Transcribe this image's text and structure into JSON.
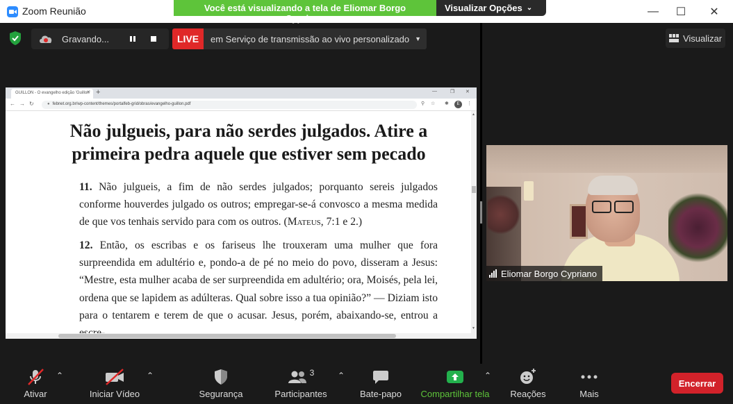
{
  "window": {
    "title": "Zoom Reunião"
  },
  "share_banner": {
    "text": "Você está visualizando a tela de Eliomar Borgo Cypriano",
    "options_label": "Visualizar Opções"
  },
  "status": {
    "recording_label": "Gravando...",
    "live_label": "LIVE",
    "stream_label": "em Serviço de transmissão ao vivo personalizado"
  },
  "view_button": {
    "label": "Visualizar"
  },
  "browser": {
    "tab_title": "GUILLON - O evangelho edição 'Guillon'",
    "url": "febnet.org.br/wp-content/themes/portalfeb-grid/obras/evangelho-guillon.pdf",
    "avatar_letter": "E"
  },
  "document": {
    "title_line1": "Não julgueis, para não serdes julgados. Atire a",
    "title_line2": "primeira pedra aquele que estiver sem pecado",
    "p11_num": "11.",
    "p11_text": "Não julgueis, a fim de não serdes julgados; porquanto sereis julgados conforme houverdes julgado os outros; empregar-se-á convosco a mesma medida de que vos tenhais servido para com os outros. (",
    "p11_ref_name": "Mateus",
    "p11_ref": ", 7:1 e 2.)",
    "p12_num": "12.",
    "p12_text": "Então, os escribas e os fariseus lhe trouxeram uma mulher que fora surpreendida em adultério e, pondo-a de pé no meio do povo, disseram a Jesus: “Mestre, esta mulher acaba de ser surpreendida em adultério; ora, Moisés, pela lei, ordena que se lapidem as adúlteras. Qual sobre isso a tua opinião?” — Diziam isto para o tentarem e terem de que o acusar. Jesus, porém, abaixando-se, entrou a escre-"
  },
  "participant": {
    "name": "Eliomar Borgo Cypriano"
  },
  "toolbar": {
    "mute_label": "Ativar",
    "video_label": "Iniciar Vídeo",
    "security_label": "Segurança",
    "participants_label": "Participantes",
    "participants_count": "3",
    "chat_label": "Bate-papo",
    "share_label": "Compartilhar tela",
    "reactions_label": "Reações",
    "more_label": "Mais",
    "end_label": "Encerrar"
  },
  "colors": {
    "share_green": "#5ec43a",
    "live_red": "#e02828",
    "end_red": "#d2222a",
    "toolbar_bg": "#1a1a1a"
  }
}
